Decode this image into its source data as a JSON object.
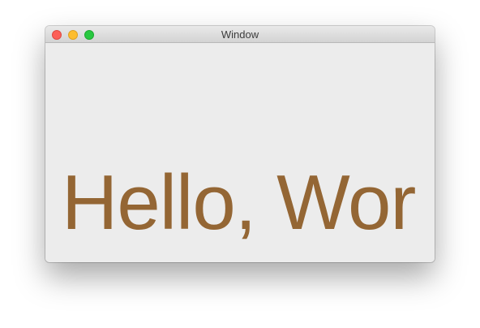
{
  "window": {
    "title": "Window"
  },
  "content": {
    "text": "Hello, Wor",
    "text_color": "#946634",
    "background_color": "#ececec"
  },
  "traffic_lights": {
    "close_color": "#fc5f57",
    "minimize_color": "#fdbd2e",
    "zoom_color": "#28c840"
  }
}
